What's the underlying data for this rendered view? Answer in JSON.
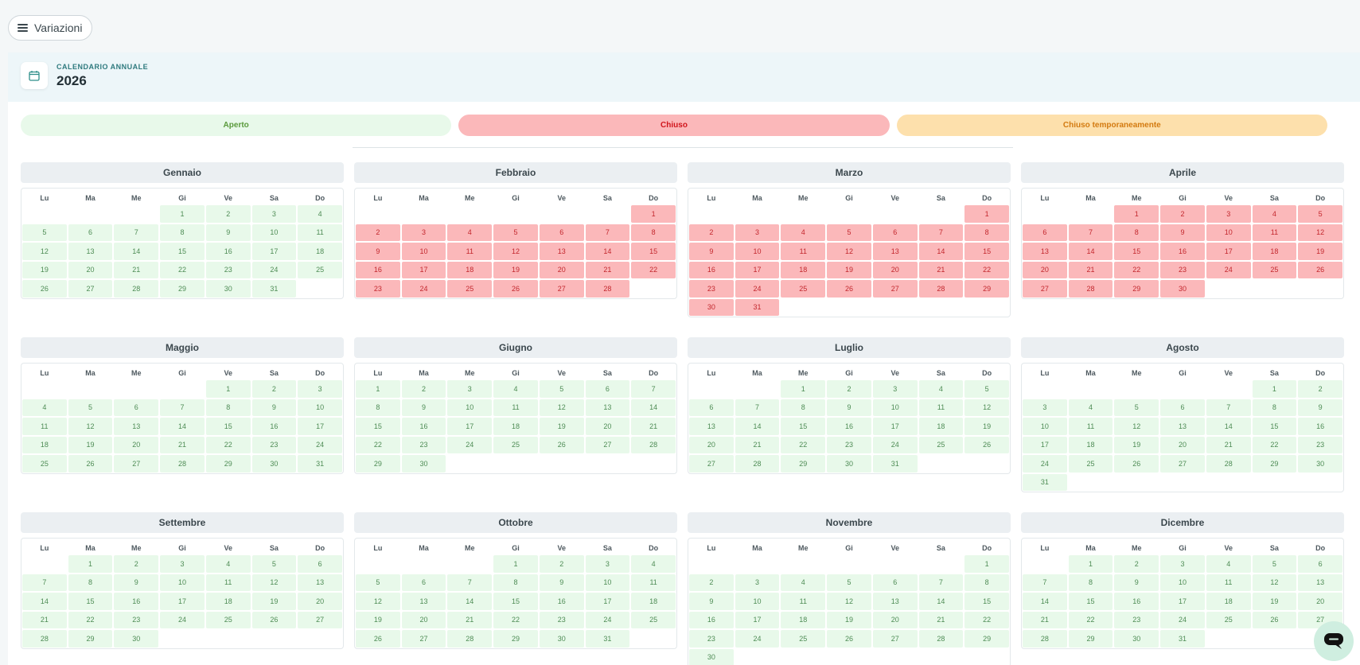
{
  "menu": {
    "label": "Variazioni"
  },
  "header": {
    "label": "CALENDARIO ANNUALE",
    "year": "2026"
  },
  "legend": [
    {
      "label": "Aperto",
      "bg": "#e8f9ea",
      "color": "#5a9a3c"
    },
    {
      "label": "Chiuso",
      "bg": "#fbb8ba",
      "color": "#d0151c"
    },
    {
      "label": "Chiuso temporaneamente",
      "bg": "#fde0ac",
      "color": "#d37a10"
    }
  ],
  "colors": {
    "open": "#e8f9ea",
    "closed": "#fbb8ba",
    "temp": "#fde0ac"
  },
  "weekdays": [
    "Lu",
    "Ma",
    "Me",
    "Gi",
    "Ve",
    "Sa",
    "Do"
  ],
  "months": [
    {
      "name": "Gennaio",
      "offset": 3,
      "days": 31,
      "status": "open"
    },
    {
      "name": "Febbraio",
      "offset": 6,
      "days": 28,
      "status": "closed"
    },
    {
      "name": "Marzo",
      "offset": 6,
      "days": 31,
      "status": "closed"
    },
    {
      "name": "Aprile",
      "offset": 2,
      "days": 30,
      "status": "closed"
    },
    {
      "name": "Maggio",
      "offset": 4,
      "days": 31,
      "status": "open"
    },
    {
      "name": "Giugno",
      "offset": 0,
      "days": 30,
      "status": "open"
    },
    {
      "name": "Luglio",
      "offset": 2,
      "days": 31,
      "status": "open"
    },
    {
      "name": "Agosto",
      "offset": 5,
      "days": 31,
      "status": "open"
    },
    {
      "name": "Settembre",
      "offset": 1,
      "days": 30,
      "status": "open"
    },
    {
      "name": "Ottobre",
      "offset": 3,
      "days": 31,
      "status": "open"
    },
    {
      "name": "Novembre",
      "offset": 6,
      "days": 30,
      "status": "open"
    },
    {
      "name": "Dicembre",
      "offset": 1,
      "days": 31,
      "status": "open"
    }
  ],
  "chat": {
    "icon": "chat-bubble-icon"
  }
}
